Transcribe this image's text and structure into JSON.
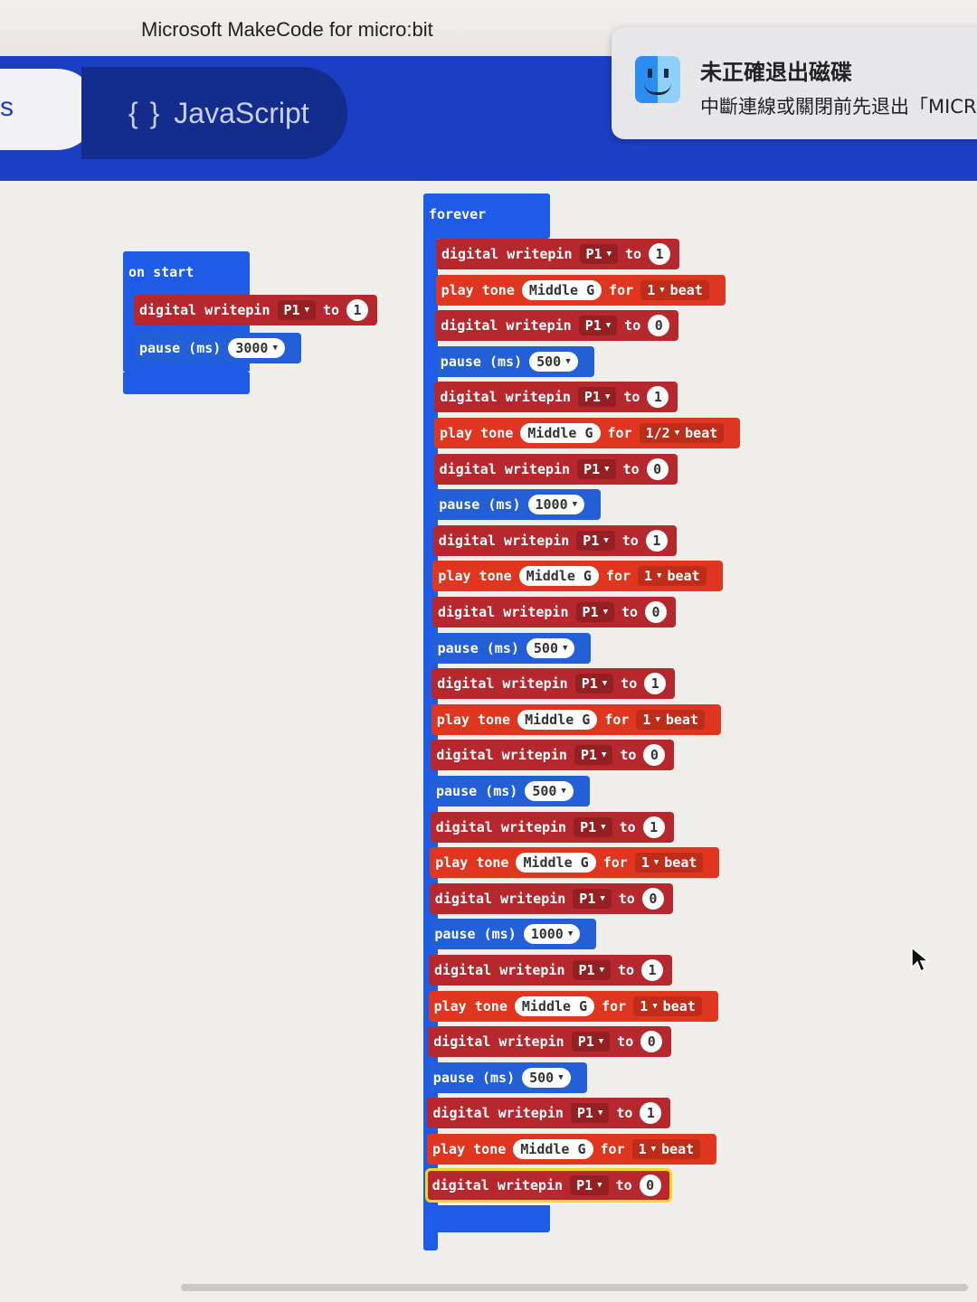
{
  "window": {
    "title": "Microsoft MakeCode for micro:bit"
  },
  "nav": {
    "blocks_tab_partial": "s",
    "js_braces": "{ }",
    "js_label": "JavaScript"
  },
  "notification": {
    "title": "未正確退出磁碟",
    "body": "中斷連線或關閉前先退出「MICR"
  },
  "on_start": {
    "label": "on start",
    "blocks": [
      {
        "type": "dw",
        "kw": "digital writepin",
        "pin": "P1",
        "to": "to",
        "val": "1"
      },
      {
        "type": "pause",
        "kw": "pause (ms)",
        "val": "3000"
      }
    ]
  },
  "forever": {
    "label": "forever",
    "blocks": [
      {
        "type": "dw",
        "kw": "digital writepin",
        "pin": "P1",
        "to": "to",
        "val": "1"
      },
      {
        "type": "tone",
        "kw": "play tone",
        "note": "Middle G",
        "for": "for",
        "beat": "1",
        "unit": "beat"
      },
      {
        "type": "dw",
        "kw": "digital writepin",
        "pin": "P1",
        "to": "to",
        "val": "0"
      },
      {
        "type": "pause",
        "kw": "pause (ms)",
        "val": "500"
      },
      {
        "type": "dw",
        "kw": "digital writepin",
        "pin": "P1",
        "to": "to",
        "val": "1"
      },
      {
        "type": "tone",
        "kw": "play tone",
        "note": "Middle G",
        "for": "for",
        "beat": "1/2",
        "unit": "beat"
      },
      {
        "type": "dw",
        "kw": "digital writepin",
        "pin": "P1",
        "to": "to",
        "val": "0"
      },
      {
        "type": "pause",
        "kw": "pause (ms)",
        "val": "1000"
      },
      {
        "type": "dw",
        "kw": "digital writepin",
        "pin": "P1",
        "to": "to",
        "val": "1"
      },
      {
        "type": "tone",
        "kw": "play tone",
        "note": "Middle G",
        "for": "for",
        "beat": "1",
        "unit": "beat"
      },
      {
        "type": "dw",
        "kw": "digital writepin",
        "pin": "P1",
        "to": "to",
        "val": "0"
      },
      {
        "type": "pause",
        "kw": "pause (ms)",
        "val": "500"
      },
      {
        "type": "dw",
        "kw": "digital writepin",
        "pin": "P1",
        "to": "to",
        "val": "1"
      },
      {
        "type": "tone",
        "kw": "play tone",
        "note": "Middle G",
        "for": "for",
        "beat": "1",
        "unit": "beat"
      },
      {
        "type": "dw",
        "kw": "digital writepin",
        "pin": "P1",
        "to": "to",
        "val": "0"
      },
      {
        "type": "pause",
        "kw": "pause (ms)",
        "val": "500"
      },
      {
        "type": "dw",
        "kw": "digital writepin",
        "pin": "P1",
        "to": "to",
        "val": "1"
      },
      {
        "type": "tone",
        "kw": "play tone",
        "note": "Middle G",
        "for": "for",
        "beat": "1",
        "unit": "beat"
      },
      {
        "type": "dw",
        "kw": "digital writepin",
        "pin": "P1",
        "to": "to",
        "val": "0"
      },
      {
        "type": "pause",
        "kw": "pause (ms)",
        "val": "1000"
      },
      {
        "type": "dw",
        "kw": "digital writepin",
        "pin": "P1",
        "to": "to",
        "val": "1"
      },
      {
        "type": "tone",
        "kw": "play tone",
        "note": "Middle G",
        "for": "for",
        "beat": "1",
        "unit": "beat"
      },
      {
        "type": "dw",
        "kw": "digital writepin",
        "pin": "P1",
        "to": "to",
        "val": "0"
      },
      {
        "type": "pause",
        "kw": "pause (ms)",
        "val": "500"
      },
      {
        "type": "dw",
        "kw": "digital writepin",
        "pin": "P1",
        "to": "to",
        "val": "1"
      },
      {
        "type": "tone",
        "kw": "play tone",
        "note": "Middle G",
        "for": "for",
        "beat": "1",
        "unit": "beat"
      },
      {
        "type": "dw",
        "kw": "digital writepin",
        "pin": "P1",
        "to": "to",
        "val": "0",
        "selected": true
      }
    ]
  },
  "colors": {
    "nav_blue": "#1b3fc4",
    "loops_blue": "#1e5be6",
    "pins_red": "#b6282d",
    "music_orange_red": "#e0361f",
    "selection_yellow": "#f5d61a"
  }
}
